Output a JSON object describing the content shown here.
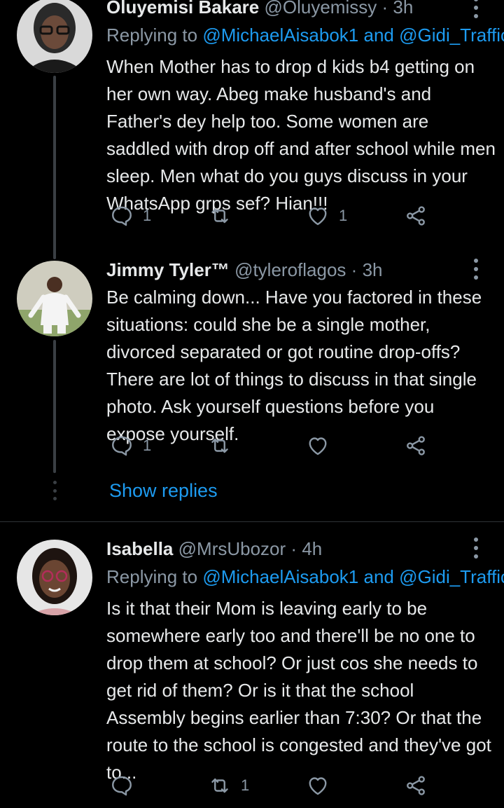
{
  "colors": {
    "background": "#000000",
    "text": "#e7e9ea",
    "muted": "#8b98a5",
    "link": "#1d9bf0",
    "line": "#3a3f44"
  },
  "tweets": [
    {
      "name": "Oluyemisi Bakare",
      "handle": "@Oluyemissy",
      "sep": "·",
      "time": "3h",
      "replying_label": "Replying to ",
      "mention1": "@MichaelAisabok1",
      "and": " and ",
      "mention2": "@Gidi_Traffic",
      "text": "When Mother has to drop d kids b4 getting on her own way. Abeg make husband's and Father's dey help too. Some women are saddled with drop off and after school while men sleep. Men what do you guys discuss in your WhatsApp grps sef? Hian!!!",
      "reply_count": "1",
      "retweet_count": "",
      "like_count": "1"
    },
    {
      "name": "Jimmy Tyler™",
      "handle": "@tyleroflagos",
      "sep": "·",
      "time": "3h",
      "text": "Be calming down... Have you factored in these situations: could she be a single mother, divorced separated or got routine drop-offs? There are lot of things to discuss in that single photo. Ask yourself questions before you expose yourself.",
      "reply_count": "1",
      "retweet_count": "",
      "like_count": ""
    },
    {
      "name": "Isabella",
      "handle": "@MrsUbozor",
      "sep": "·",
      "time": "4h",
      "replying_label": "Replying to ",
      "mention1": "@MichaelAisabok1",
      "and": " and ",
      "mention2": "@Gidi_Traffic",
      "text": "Is it that their Mom is leaving early to be somewhere early too and there'll be no one to drop them at school? Or just cos she needs to get rid of them? Or is it that the school Assembly begins earlier than 7:30? Or that the route to the school is congested and they've got to...",
      "reply_count": "",
      "retweet_count": "1",
      "like_count": ""
    }
  ],
  "show_replies": "Show replies",
  "icons": [
    "reply-icon",
    "retweet-icon",
    "like-icon",
    "share-icon",
    "more-icon"
  ]
}
